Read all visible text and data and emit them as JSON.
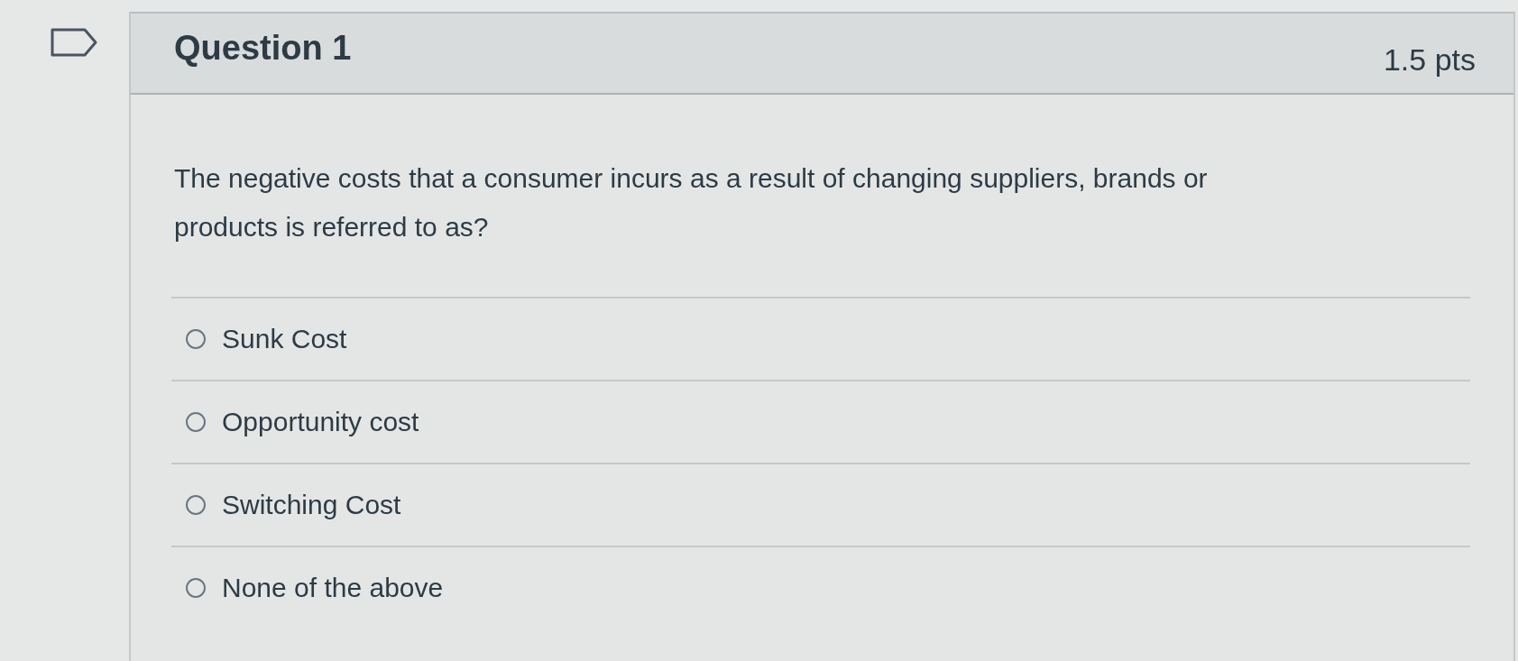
{
  "question": {
    "flagged": false,
    "title": "Question 1",
    "points": "1.5 pts",
    "text": "The negative costs that a consumer incurs as a result of changing suppliers, brands or products is referred to as?"
  },
  "answers": [
    {
      "label": "Sunk Cost",
      "selected": false
    },
    {
      "label": "Opportunity cost",
      "selected": false
    },
    {
      "label": "Switching Cost",
      "selected": false
    },
    {
      "label": "None of the above",
      "selected": false
    }
  ]
}
